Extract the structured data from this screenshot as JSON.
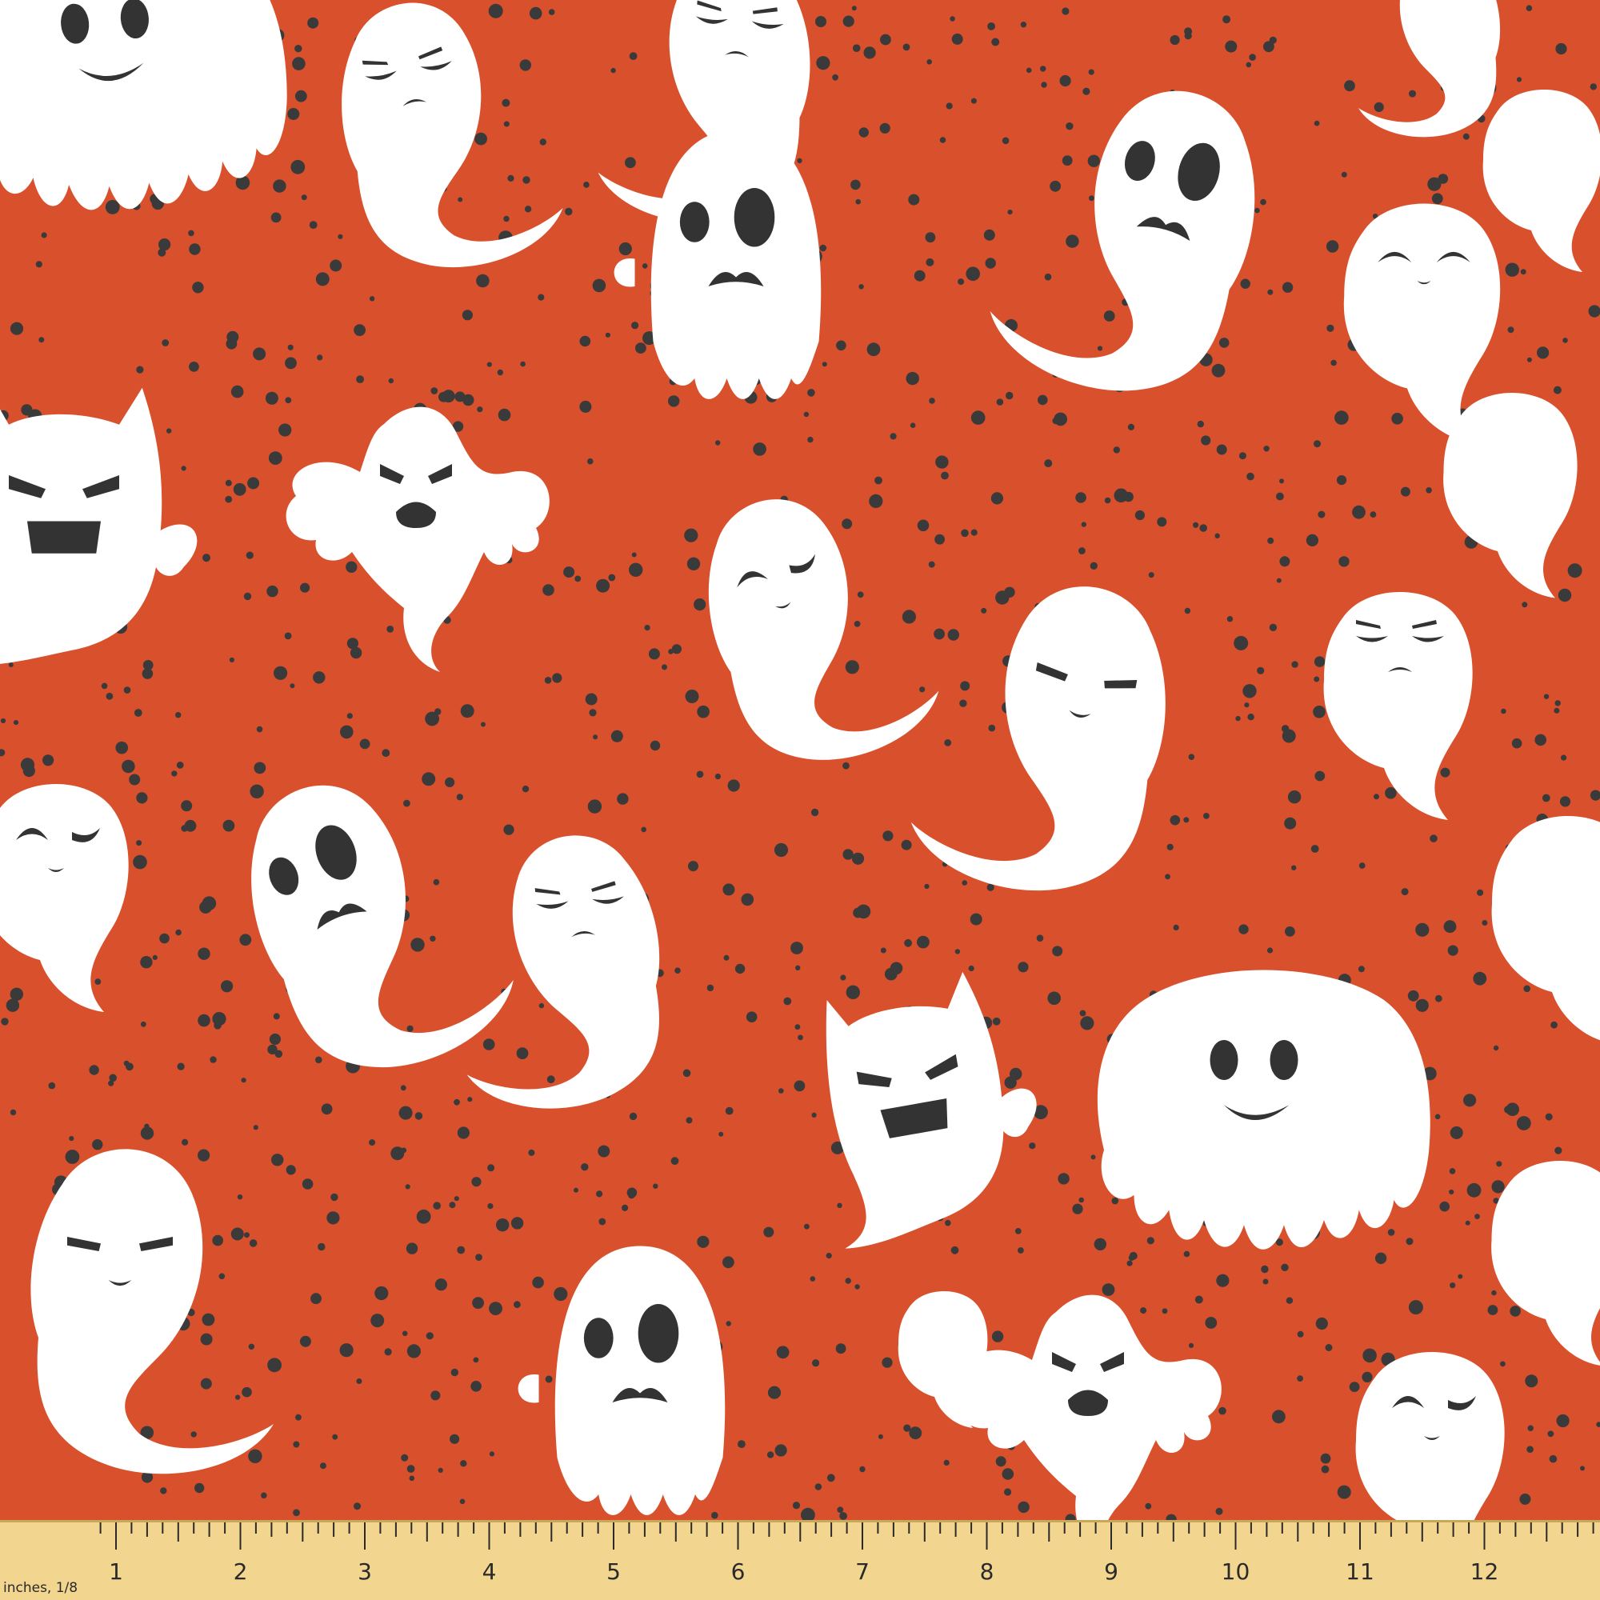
{
  "fabric": {
    "background_color": "#d9502c",
    "ghost_color": "#ffffff",
    "dot_color": "#3a3a3a",
    "face_color": "#333333",
    "ghost_count": 26
  },
  "ruler": {
    "background_color": "#f2d58e",
    "unit_label": "inches, 1/8",
    "numbers": [
      "1",
      "2",
      "3",
      "4",
      "5",
      "6",
      "7",
      "8",
      "9",
      "10",
      "11",
      "12",
      "1"
    ]
  }
}
